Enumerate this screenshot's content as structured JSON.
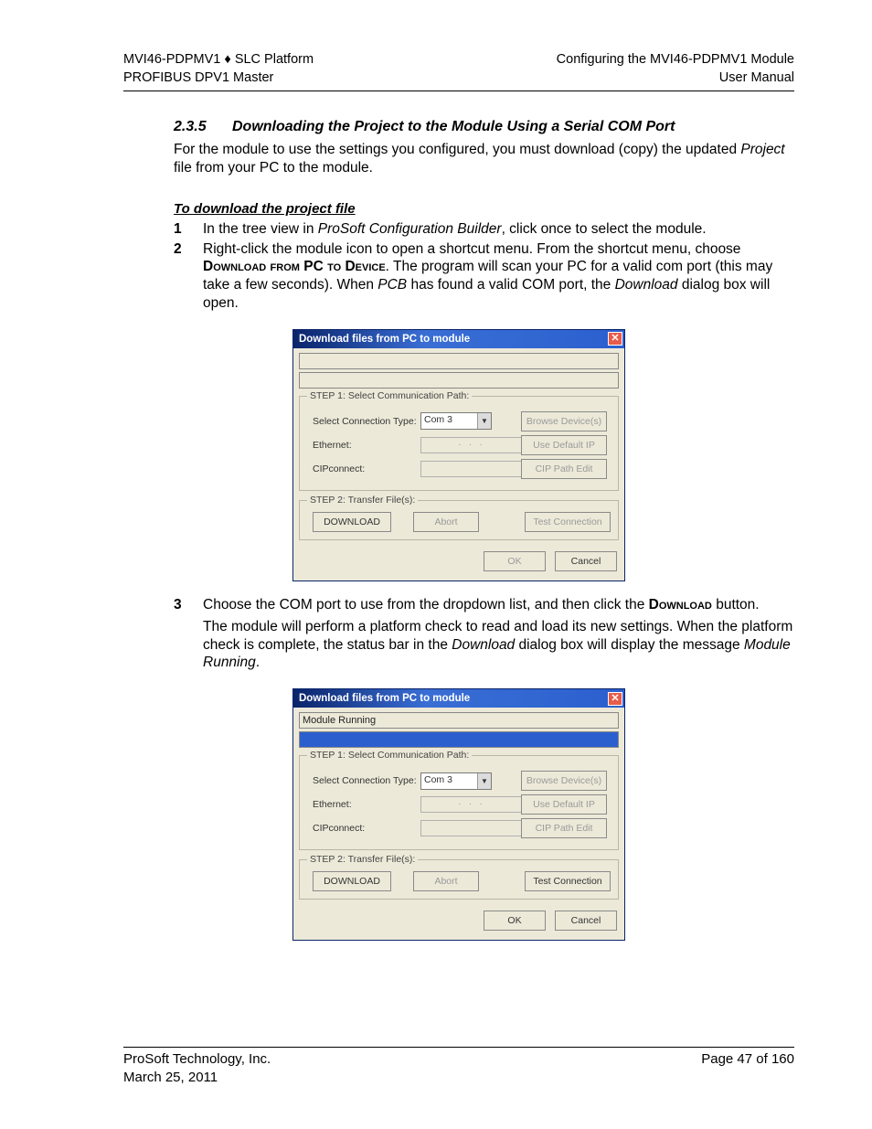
{
  "header": {
    "left1": "MVI46-PDPMV1 ♦ SLC Platform",
    "left2": "PROFIBUS DPV1 Master",
    "right1": "Configuring the MVI46-PDPMV1 Module",
    "right2": "User Manual"
  },
  "section": {
    "number": "2.3.5",
    "title": "Downloading the Project to the Module Using a Serial COM Port"
  },
  "intro": "For the module to use the settings you configured, you must download (copy) the updated Project file from your PC to the module.",
  "subhead": "To download the project file",
  "steps": {
    "s1": {
      "n": "1",
      "pre": "In the tree view in ",
      "it": "ProSoft Configuration Builder",
      "post": ", click once to select the module."
    },
    "s2": {
      "n": "2",
      "pre": "Right-click the module icon to open a shortcut menu. From the shortcut menu, choose ",
      "sc1": "Download from PC to Device",
      "mid": ". The program will scan your PC for a valid com port (this may take a few seconds). When ",
      "it": "PCB",
      "post": " has found a valid COM port, the ",
      "it2": "Download",
      "post2": " dialog box will open."
    },
    "s3": {
      "n": "3",
      "pre": "Choose the COM port to use from the dropdown list, and then click the ",
      "sc1": "Download",
      "post": " button."
    }
  },
  "after3": {
    "l1a": "The module will perform a platform check to read and load its new settings. When the platform check is complete, the status bar in the ",
    "l1it": "Download",
    "l1b": " dialog box will display the message ",
    "l1it2": "Module Running",
    "l1c": "."
  },
  "dialog": {
    "title": "Download files from PC to module",
    "status_empty": "",
    "status_running": "Module Running",
    "step1_legend": "STEP 1: Select Communication Path:",
    "step2_legend": "STEP 2: Transfer File(s):",
    "lbl_conn": "Select Connection Type:",
    "lbl_eth": "Ethernet:",
    "lbl_cip": "CIPconnect:",
    "dd_value": "Com 3",
    "ip_dots": ".   .   .",
    "btn_browse": "Browse Device(s)",
    "btn_defip": "Use Default IP",
    "btn_cip": "CIP Path Edit",
    "btn_download": "DOWNLOAD",
    "btn_abort": "Abort",
    "btn_test": "Test Connection",
    "btn_ok": "OK",
    "btn_cancel": "Cancel"
  },
  "footer": {
    "left1": "ProSoft Technology, Inc.",
    "left2": "March 25, 2011",
    "right1": "Page 47 of 160"
  }
}
